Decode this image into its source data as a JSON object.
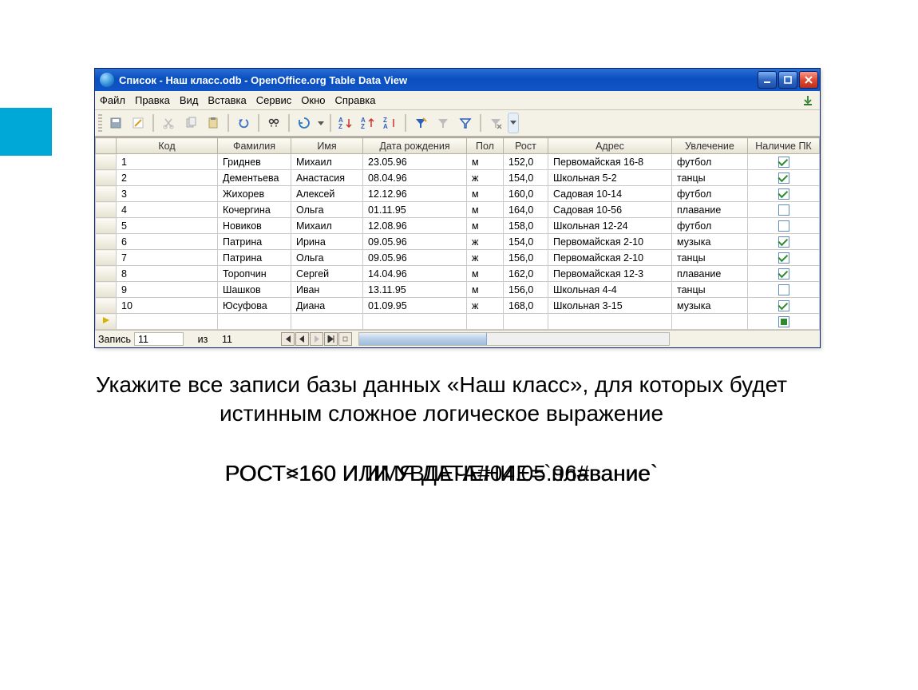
{
  "window": {
    "title": "Список - Наш класс.odb - OpenOffice.org Table Data View"
  },
  "menubar": {
    "items": [
      "Файл",
      "Правка",
      "Вид",
      "Вставка",
      "Сервис",
      "Окно",
      "Справка"
    ]
  },
  "columns": [
    "Код",
    "Фамилия",
    "Имя",
    "Дата рождения",
    "Пол",
    "Рост",
    "Адрес",
    "Увлечение",
    "Наличие ПК"
  ],
  "rows": [
    {
      "kod": "1",
      "fam": "Гриднев",
      "im": "Михаил",
      "dob": "23.05.96",
      "pol": "м",
      "rost": "152,0",
      "adr": "Первомайская 16-8",
      "uvl": "футбол",
      "pc": true
    },
    {
      "kod": "2",
      "fam": "Дементьева",
      "im": "Анастасия",
      "dob": "08.04.96",
      "pol": "ж",
      "rost": "154,0",
      "adr": "Школьная 5-2",
      "uvl": "танцы",
      "pc": true
    },
    {
      "kod": "3",
      "fam": "Жихорев",
      "im": "Алексей",
      "dob": "12.12.96",
      "pol": "м",
      "rost": "160,0",
      "adr": "Садовая 10-14",
      "uvl": "футбол",
      "pc": true
    },
    {
      "kod": "4",
      "fam": "Кочергина",
      "im": "Ольга",
      "dob": "01.11.95",
      "pol": "м",
      "rost": "164,0",
      "adr": "Садовая 10-56",
      "uvl": "плавание",
      "pc": false
    },
    {
      "kod": "5",
      "fam": "Новиков",
      "im": "Михаил",
      "dob": "12.08.96",
      "pol": "м",
      "rost": "158,0",
      "adr": "Школьная 12-24",
      "uvl": "футбол",
      "pc": false
    },
    {
      "kod": "6",
      "fam": "Патрина",
      "im": "Ирина",
      "dob": "09.05.96",
      "pol": "ж",
      "rost": "154,0",
      "adr": "Первомайская 2-10",
      "uvl": "музыка",
      "pc": true
    },
    {
      "kod": "7",
      "fam": "Патрина",
      "im": "Ольга",
      "dob": "09.05.96",
      "pol": "ж",
      "rost": "156,0",
      "adr": "Первомайская 2-10",
      "uvl": "танцы",
      "pc": true
    },
    {
      "kod": "8",
      "fam": "Торопчин",
      "im": "Сергей",
      "dob": "14.04.96",
      "pol": "м",
      "rost": "162,0",
      "adr": "Первомайская 12-3",
      "uvl": "плавание",
      "pc": true
    },
    {
      "kod": "9",
      "fam": "Шашков",
      "im": "Иван",
      "dob": "13.11.95",
      "pol": "м",
      "rost": "156,0",
      "adr": "Школьная 4-4",
      "uvl": "танцы",
      "pc": false
    },
    {
      "kod": "10",
      "fam": "Юсуфова",
      "im": "Диана",
      "dob": "01.09.95",
      "pol": "ж",
      "rost": "168,0",
      "adr": "Школьная 3-15",
      "uvl": "музыка",
      "pc": true
    }
  ],
  "statusbar": {
    "label_record": "Запись",
    "current": "11",
    "of_label": "из",
    "total": "11"
  },
  "question": {
    "line1": "Укажите все записи базы данных «Наш класс», для которых будет истинным сложное логическое выражение",
    "overlay1": "РОСТ>160 ИЛИ УВЛЕЧЕНИЕ=`плавание`",
    "overlay2": "РОСТ<160 И ИМЯ ДАТА#04.05.96#вание`"
  }
}
